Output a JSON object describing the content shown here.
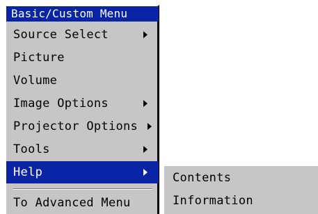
{
  "menu": {
    "title": "Basic/Custom Menu",
    "items": [
      {
        "label": "Source Select",
        "has_submenu": true
      },
      {
        "label": "Picture",
        "has_submenu": false
      },
      {
        "label": "Volume",
        "has_submenu": false
      },
      {
        "label": "Image Options",
        "has_submenu": true
      },
      {
        "label": "Projector Options",
        "has_submenu": true
      },
      {
        "label": "Tools",
        "has_submenu": true
      },
      {
        "label": "Help",
        "has_submenu": true,
        "selected": true
      },
      {
        "label": "To Advanced Menu",
        "has_submenu": false
      }
    ]
  },
  "submenu": {
    "items": [
      {
        "label": "Contents"
      },
      {
        "label": "Information"
      }
    ]
  },
  "colors": {
    "highlight": "#0a24a6",
    "panel": "#c6c6c6"
  },
  "icons": {
    "submenu_arrow": "triangle-right-icon"
  }
}
